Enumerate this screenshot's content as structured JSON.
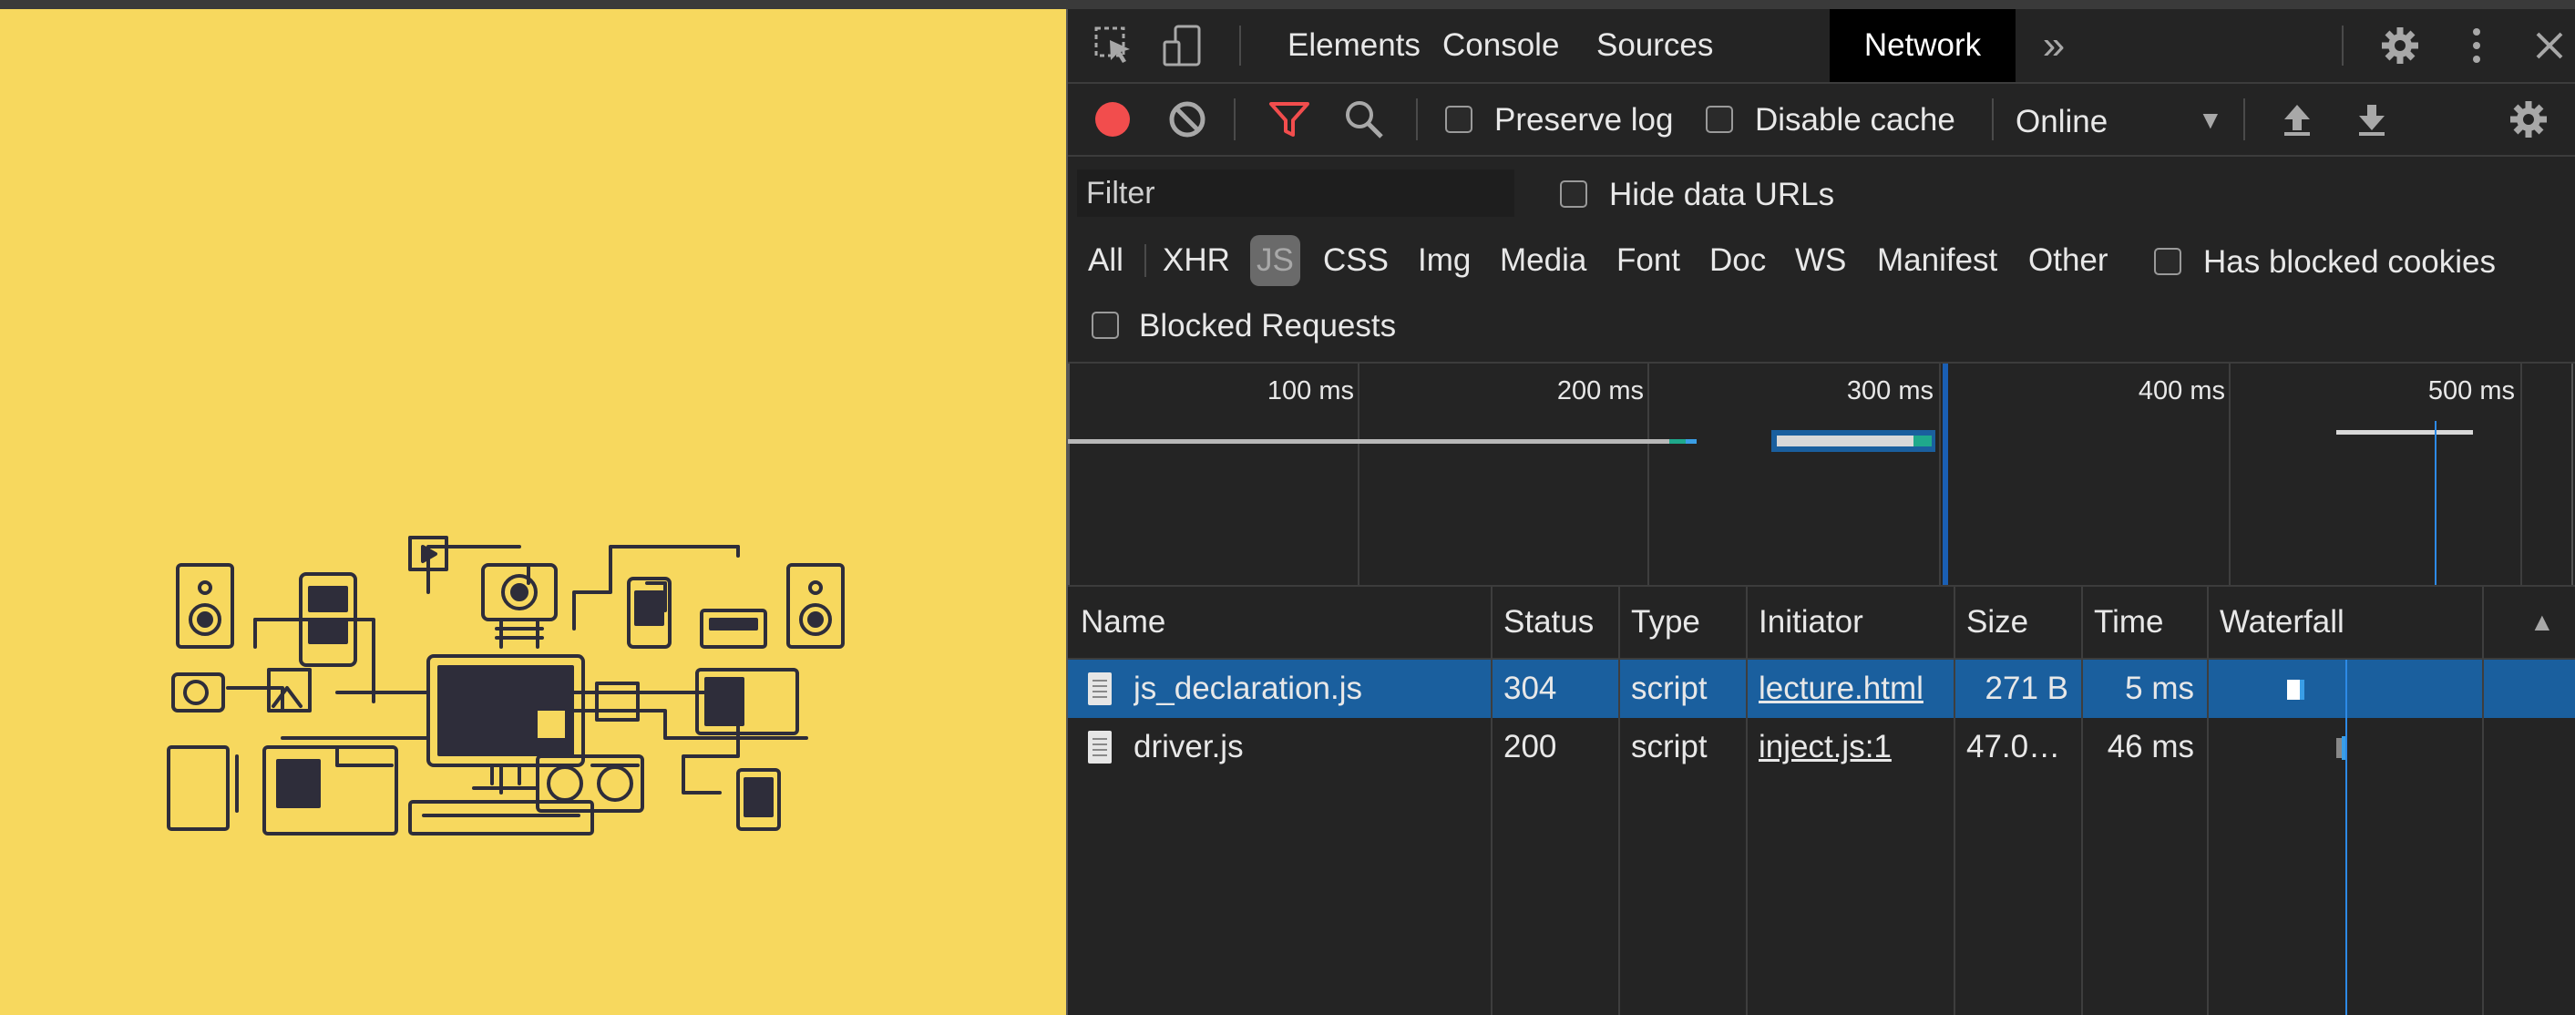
{
  "devtools": {
    "tabs": [
      "Elements",
      "Console",
      "Sources",
      "Network"
    ],
    "active_tab": "Network",
    "more_tabs_glyph": "»",
    "icons": [
      "inspect-element-icon",
      "device-toggle-icon",
      "settings-gear-icon",
      "more-vertical-icon",
      "close-icon"
    ]
  },
  "toolbar": {
    "preserve_log_label": "Preserve log",
    "preserve_log_checked": false,
    "disable_cache_label": "Disable cache",
    "disable_cache_checked": false,
    "throttling_value": "Online",
    "record_color": "#f24d4d",
    "filter_icon_color": "#f24d4d"
  },
  "filter": {
    "placeholder": "Filter",
    "hide_data_urls_label": "Hide data URLs",
    "types": [
      "All",
      "XHR",
      "JS",
      "CSS",
      "Img",
      "Media",
      "Font",
      "Doc",
      "WS",
      "Manifest",
      "Other"
    ],
    "active_type": "JS",
    "has_blocked_cookies_label": "Has blocked cookies",
    "blocked_requests_label": "Blocked Requests"
  },
  "overview": {
    "ticks": [
      "100 ms",
      "200 ms",
      "300 ms",
      "400 ms",
      "500 ms"
    ]
  },
  "table": {
    "columns": [
      "Name",
      "Status",
      "Type",
      "Initiator",
      "Size",
      "Time",
      "Waterfall"
    ],
    "sort_indicator": "▲",
    "rows": [
      {
        "name": "js_declaration.js",
        "status": "304",
        "type": "script",
        "initiator": "lecture.html",
        "size": "271 B",
        "time": "5 ms",
        "selected": true
      },
      {
        "name": "driver.js",
        "status": "200",
        "type": "script",
        "initiator": "inject.js:1",
        "size": "47.0…",
        "time": "46 ms",
        "selected": false
      }
    ]
  },
  "colors": {
    "page_background": "#f7d85e",
    "selected_row": "#1a5f9e",
    "timeline_marker": "#2d8ae6"
  }
}
